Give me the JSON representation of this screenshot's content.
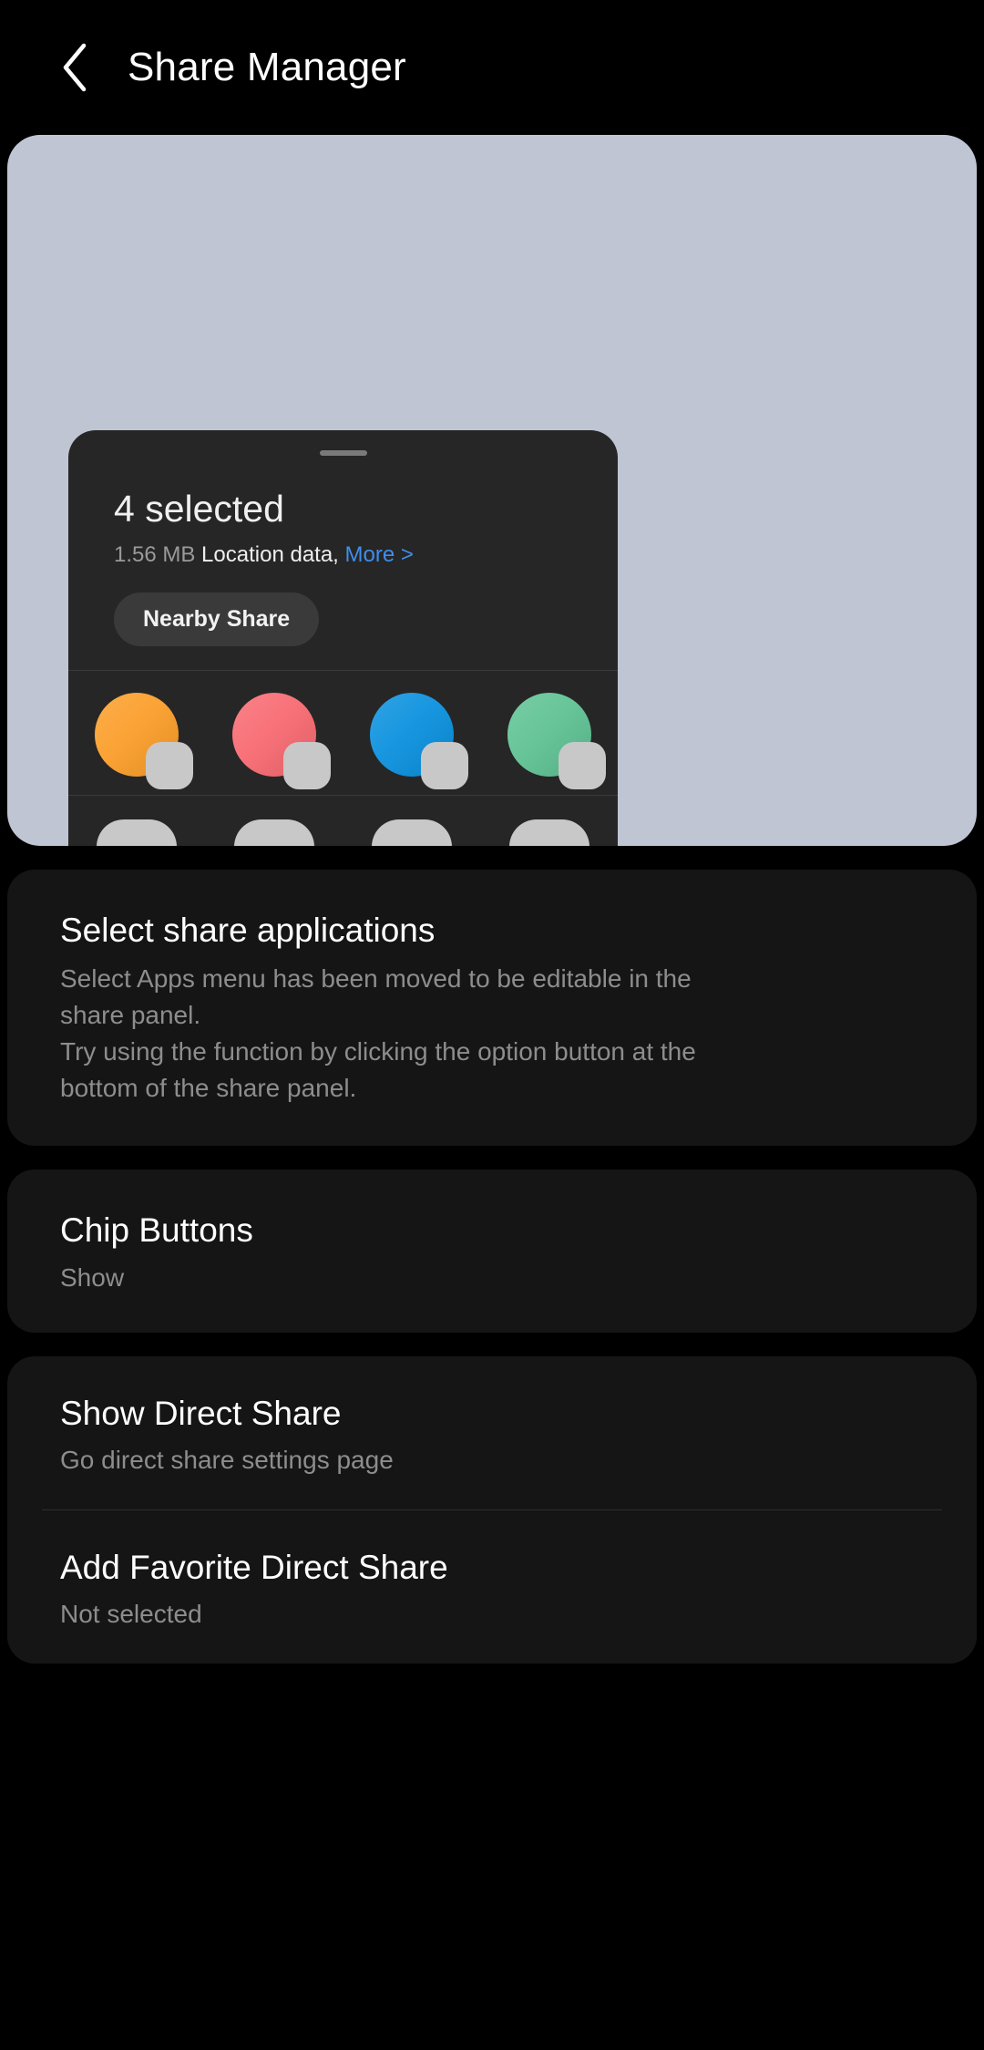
{
  "header": {
    "back_icon": "chevron-left-icon",
    "title": "Share Manager"
  },
  "preview": {
    "backdrop_color": "#bfc5d2",
    "panel": {
      "handle": "drag-handle",
      "title": "4 selected",
      "subtitle_size": "1.56 MB",
      "subtitle_kind": " Location data,",
      "subtitle_more": " More >",
      "chip_label": "Nearby Share",
      "app_icons": [
        {
          "name": "app-icon-orange",
          "color": "#FB9E2A"
        },
        {
          "name": "app-icon-red",
          "color": "#F86A72"
        },
        {
          "name": "app-icon-blue",
          "color": "#0B91DE"
        },
        {
          "name": "app-icon-green",
          "color": "#5FC294"
        }
      ],
      "placeholders": [
        {
          "name": "app-placeholder-1",
          "color": "#c8c8c8"
        },
        {
          "name": "app-placeholder-2",
          "color": "#c8c8c8"
        },
        {
          "name": "app-placeholder-3",
          "color": "#c8c8c8"
        },
        {
          "name": "app-placeholder-4",
          "color": "#c8c8c8"
        }
      ]
    }
  },
  "settings": {
    "select_share": {
      "title": "Select share applications",
      "desc_line1": "Select Apps menu has been moved to be editable in the",
      "desc_line2": "share panel.",
      "desc_line3": "Try using the function by clicking the option button at the",
      "desc_line4": "bottom of the share panel."
    },
    "chip_buttons": {
      "title": "Chip Buttons",
      "value": "Show"
    },
    "show_direct_share": {
      "title": "Show Direct Share",
      "value": "Go direct share settings page"
    },
    "add_favorite_direct_share": {
      "title": "Add Favorite Direct Share",
      "value": "Not selected"
    }
  },
  "colors": {
    "accent_blue": "#3f8eea",
    "card_bg": "#151515",
    "panel_bg": "#262626",
    "page_bg": "#000000"
  }
}
